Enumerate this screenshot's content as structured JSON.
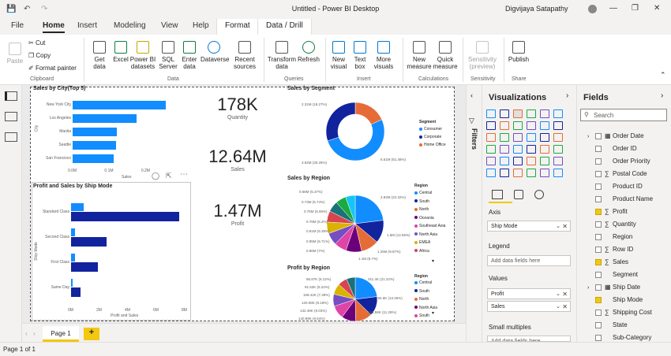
{
  "window": {
    "title": "Untitled - Power BI Desktop",
    "user": "Digvijaya Satapathy"
  },
  "menu": {
    "file": "File",
    "home": "Home",
    "insert": "Insert",
    "modeling": "Modeling",
    "view": "View",
    "help": "Help",
    "format": "Format",
    "data_drill": "Data / Drill"
  },
  "ribbon": {
    "paste": "Paste",
    "cut": "Cut",
    "copy": "Copy",
    "format_painter": "Format painter",
    "get_data": "Get data",
    "excel": "Excel",
    "pbi_datasets": "Power BI datasets",
    "sql_server": "SQL Server",
    "enter_data": "Enter data",
    "dataverse": "Dataverse",
    "recent_sources": "Recent sources",
    "transform_data": "Transform data",
    "refresh": "Refresh",
    "new_visual": "New visual",
    "text_box": "Text box",
    "more_visuals": "More visuals",
    "new_measure": "New measure",
    "quick_measure": "Quick measure",
    "sensitivity": "Sensitivity (preview)",
    "publish": "Publish",
    "groups": {
      "clipboard": "Clipboard",
      "data": "Data",
      "queries": "Queries",
      "insert": "Insert",
      "calculations": "Calculations",
      "sensitivity": "Sensitivity",
      "share": "Share"
    }
  },
  "charts": {
    "city": {
      "title": "Sales by City(Top 5)",
      "xlabel": "Sales",
      "ylabel": "City",
      "ticks": [
        "0.0M",
        "0.1M",
        "0.2M"
      ]
    },
    "shipmode": {
      "title": "Profit and Sales by Ship Mode",
      "xlabel": "Profit and Sales",
      "ylabel": "Ship Mode",
      "ticks": [
        "0M",
        "2M",
        "4M",
        "6M",
        "8M"
      ]
    },
    "segment": {
      "title": "Sales by Segment",
      "legend_title": "Segment",
      "labels": [
        "2.31M (18.27%)",
        "6.51M (51.48%)",
        "3.82M (30.25%)"
      ]
    },
    "region": {
      "title": "Sales by Region",
      "legend_title": "Region",
      "labels_left": [
        "0.68M (5.37%)",
        "0.73M (5.74%)",
        "0.75M (5.95%)",
        "0.78M (6.2%)",
        "0.81M (6.38%)",
        "0.85M (6.71%)",
        "0.86M (7%)"
      ],
      "labels_right": [
        "2.82M (22.32%)",
        "1.6M (12.66%)",
        "1.25M (9.87%)",
        "1.1M (8.7%)"
      ]
    },
    "profit_region": {
      "title": "Profit by Region",
      "legend_title": "Region",
      "labels_left": [
        "86.87K (6.12%)",
        "91.52K (6.24%)",
        "108.42K (7.39%)",
        "120.08K (8.18%)",
        "132.48K (9.03%)",
        "140.99K (9.64%)"
      ],
      "labels_right": [
        "311.4K (21.22%)",
        "194.6K (13.26%)",
        "165.58K (11.28%)"
      ]
    }
  },
  "chart_data": [
    {
      "type": "bar",
      "title": "Sales by City(Top 5)",
      "categories": [
        "New York City",
        "Los Angeles",
        "Manila",
        "Seattle",
        "San Francisco"
      ],
      "values": [
        0.255,
        0.175,
        0.12,
        0.119,
        0.112
      ],
      "xlabel": "Sales",
      "ylabel": "City",
      "xticks": [
        "0.0M",
        "0.1M",
        "0.2M"
      ]
    },
    {
      "type": "bar",
      "title": "Profit and Sales by Ship Mode",
      "categories": [
        "Standard Class",
        "Second Class",
        "First Class",
        "Same Day"
      ],
      "series": [
        {
          "values": [
            0.9,
            0.28,
            0.3,
            0.1
          ]
        },
        {
          "values": [
            7.6,
            2.5,
            1.9,
            0.65
          ]
        }
      ],
      "xlabel": "Profit and Sales",
      "ylabel": "Ship Mode",
      "xlim": [
        0,
        8
      ],
      "xticks": [
        "0M",
        "2M",
        "4M",
        "6M",
        "8M"
      ]
    },
    {
      "type": "pie",
      "title": "Sales by Segment",
      "categories": [
        "Consumer",
        "Corporate",
        "Home Office"
      ],
      "values": [
        6.51,
        3.82,
        2.31
      ]
    },
    {
      "type": "pie",
      "title": "Sales by Region",
      "categories": [
        "Central",
        "South",
        "North",
        "Oceania",
        "Southeast Asia",
        "North Asia",
        "EMEA",
        "Africa"
      ],
      "values": [
        2.82,
        1.6,
        1.25,
        1.1,
        0.86,
        0.85,
        0.81,
        0.78,
        0.75,
        0.73,
        0.68
      ]
    },
    {
      "type": "pie",
      "title": "Profit by Region",
      "categories": [
        "Central",
        "South",
        "North",
        "North Asia",
        "South"
      ],
      "values": [
        311.4,
        194.6,
        165.58,
        140.99,
        132.48,
        120.08,
        108.42,
        91.52,
        86.87
      ]
    }
  ],
  "cards": [
    {
      "value": "178K",
      "label": "Quantity"
    },
    {
      "value": "12.64M",
      "label": "Sales"
    },
    {
      "value": "1.47M",
      "label": "Profit"
    }
  ],
  "legends": {
    "segment": [
      "Consumer",
      "Corporate",
      "Home Office"
    ],
    "region": [
      "Central",
      "South",
      "North",
      "Oceania",
      "Southeast Asia",
      "North Asia",
      "EMEA",
      "Africa"
    ],
    "profit_region": [
      "Central",
      "South",
      "North",
      "North Asia",
      "South"
    ]
  },
  "colors": {
    "c1": "#118dff",
    "c2": "#12239e",
    "c3": "#e66c37",
    "c4": "#6b007b",
    "c5": "#e044a7",
    "c6": "#744ec2",
    "c7": "#d9b300",
    "c8": "#d64550",
    "c9": "#197278",
    "c10": "#1aab40",
    "c11": "#15c6f4"
  },
  "pages": {
    "page1": "Page 1",
    "add": "+"
  },
  "status": "Page 1 of 1",
  "filters": "Filters",
  "viz": {
    "title": "Visualizations",
    "axis": "Axis",
    "axis_value": "Ship Mode",
    "legend": "Legend",
    "legend_ph": "Add data fields here",
    "values": "Values",
    "val1": "Profit",
    "val2": "Sales",
    "small_multiples": "Small multiples",
    "sm_ph": "Add data fields here"
  },
  "fields": {
    "title": "Fields",
    "search_ph": "Search",
    "items": [
      {
        "name": "Order Date",
        "checked": false,
        "kind": "date"
      },
      {
        "name": "Order ID",
        "checked": false,
        "kind": ""
      },
      {
        "name": "Order Priority",
        "checked": false,
        "kind": ""
      },
      {
        "name": "Postal Code",
        "checked": false,
        "kind": "sigma"
      },
      {
        "name": "Product ID",
        "checked": false,
        "kind": ""
      },
      {
        "name": "Product Name",
        "checked": false,
        "kind": ""
      },
      {
        "name": "Profit",
        "checked": true,
        "kind": "sigma"
      },
      {
        "name": "Quantity",
        "checked": false,
        "kind": "sigma"
      },
      {
        "name": "Region",
        "checked": false,
        "kind": ""
      },
      {
        "name": "Row ID",
        "checked": false,
        "kind": "sigma"
      },
      {
        "name": "Sales",
        "checked": true,
        "kind": "sigma"
      },
      {
        "name": "Segment",
        "checked": false,
        "kind": ""
      },
      {
        "name": "Ship Date",
        "checked": false,
        "kind": "date"
      },
      {
        "name": "Ship Mode",
        "checked": true,
        "kind": ""
      },
      {
        "name": "Shipping Cost",
        "checked": false,
        "kind": "sigma"
      },
      {
        "name": "State",
        "checked": false,
        "kind": ""
      },
      {
        "name": "Sub-Category",
        "checked": false,
        "kind": ""
      }
    ]
  }
}
